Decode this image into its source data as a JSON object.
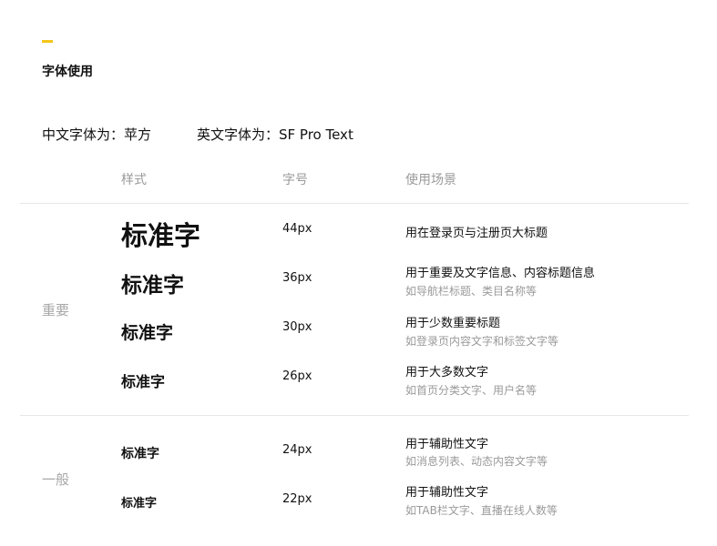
{
  "accent_color": "#f5c518",
  "section_title": "字体使用",
  "fonts": {
    "chinese": "中文字体为：苹方",
    "english": "英文字体为：SF Pro Text"
  },
  "columns": {
    "style": "样式",
    "size": "字号",
    "usage": "使用场景"
  },
  "groups": {
    "important": "重要",
    "general": "一般"
  },
  "rows": [
    {
      "sample": "标准字",
      "size": "44px",
      "usage": "用在登录页与注册页大标题",
      "note": ""
    },
    {
      "sample": "标准字",
      "size": "36px",
      "usage": "用于重要及文字信息、内容标题信息",
      "note": "如导航栏标题、类目名称等"
    },
    {
      "sample": "标准字",
      "size": "30px",
      "usage": "用于少数重要标题",
      "note": "如登录页内容文字和标签文字等"
    },
    {
      "sample": "标准字",
      "size": "26px",
      "usage": "用于大多数文字",
      "note": "如首页分类文字、用户名等"
    },
    {
      "sample": "标准字",
      "size": "24px",
      "usage": "用于辅助性文字",
      "note": "如消息列表、动态内容文字等"
    },
    {
      "sample": "标准字",
      "size": "22px",
      "usage": "用于辅助性文字",
      "note": "如TAB栏文字、直播在线人数等"
    }
  ]
}
